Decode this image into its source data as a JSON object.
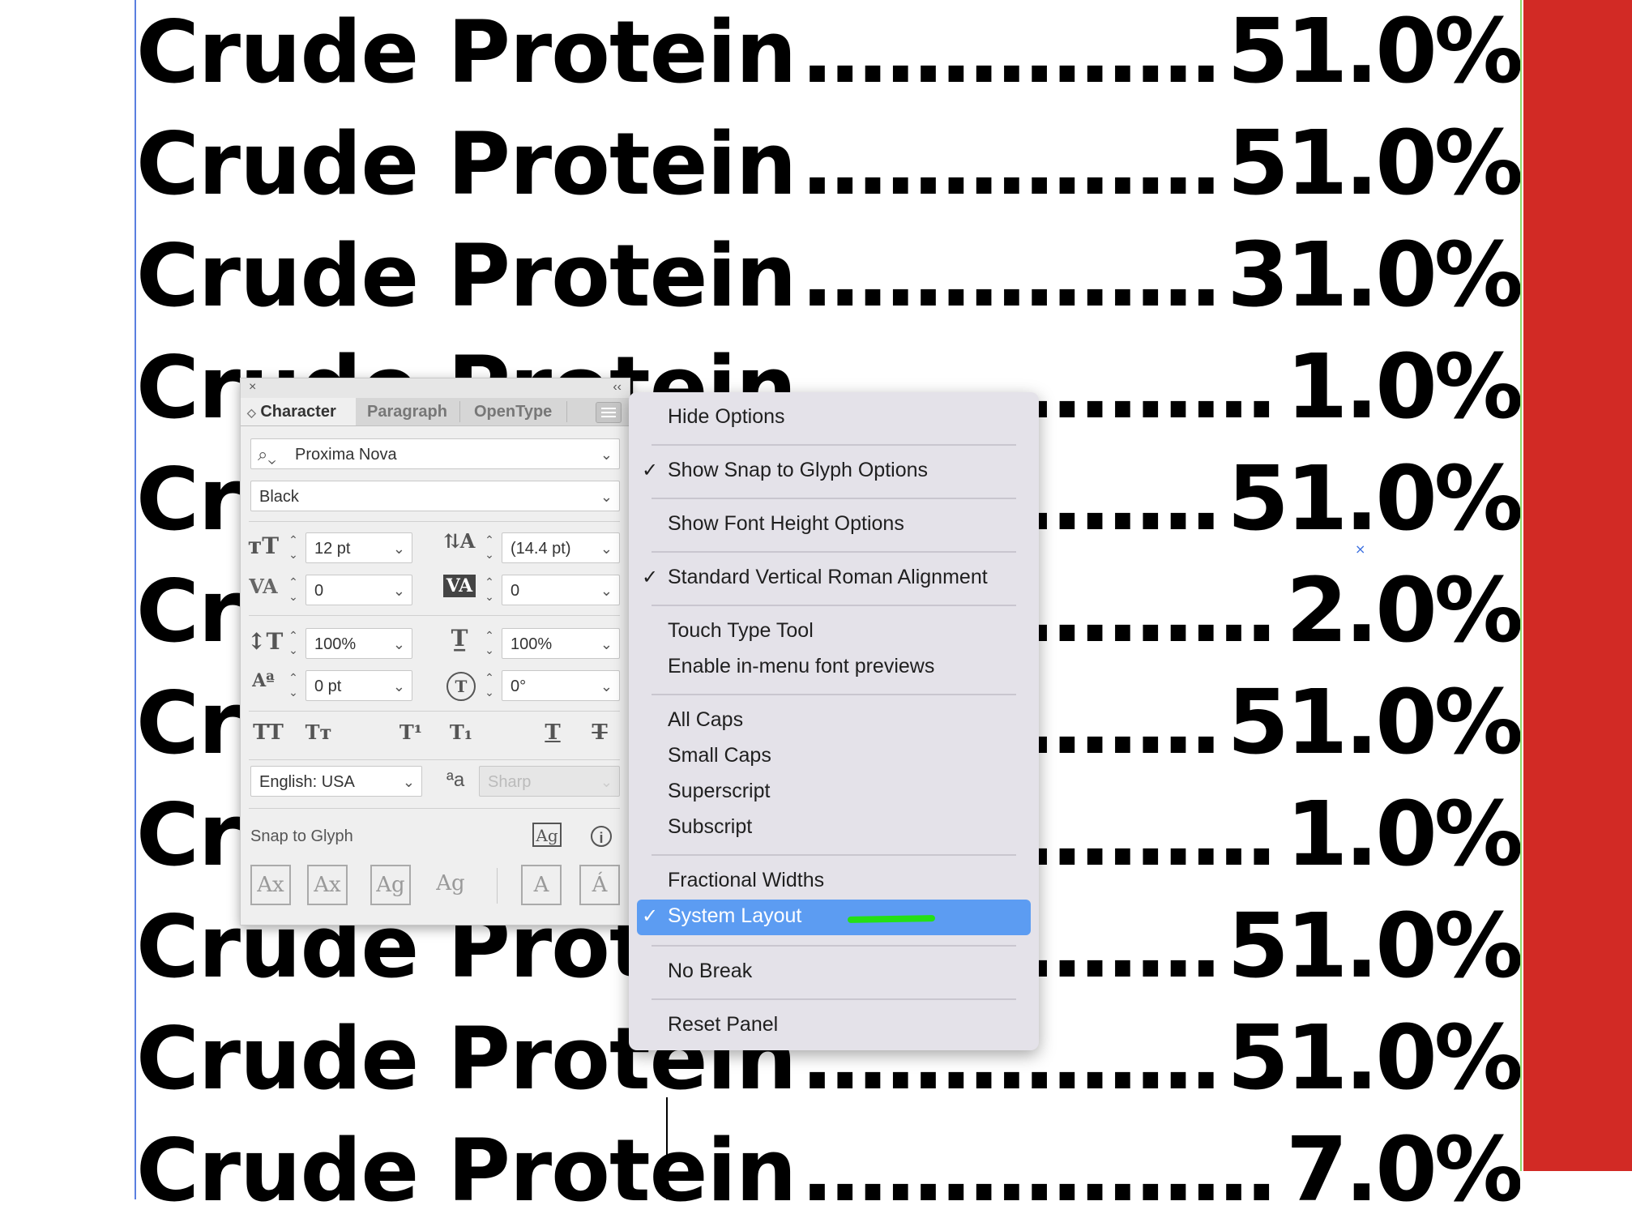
{
  "document": {
    "rows": [
      {
        "label": "Crude Protein",
        "dots": "..........................................",
        "value": "51.0%"
      },
      {
        "label": "Crude Protein",
        "dots": "..........................................",
        "value": "51.0%"
      },
      {
        "label": "Crude Protein",
        "dots": "..........................................",
        "value": "31.0%"
      },
      {
        "label": "Crude Protein",
        "dots": "..........................................",
        "value": "1.0%"
      },
      {
        "label": "Crude Protein",
        "dots": "..........................................",
        "value": "51.0%"
      },
      {
        "label": "Crude Protein",
        "dots": "..........................................",
        "value": "2.0%"
      },
      {
        "label": "Crude Protein",
        "dots": "..........................................",
        "value": "51.0%"
      },
      {
        "label": "Crude Protein",
        "dots": "..........................................",
        "value": "1.0%"
      },
      {
        "label": "Crude Protein",
        "dots": "..........................................",
        "value": "51.0%"
      },
      {
        "label": "Crude Protein",
        "dots": "..........................................",
        "value": "51.0%"
      },
      {
        "label": "Crude Protein",
        "dots": "..........................................",
        "value": "7.0%"
      }
    ],
    "accent_color": "#d22a25",
    "guide_left_color": "#5a7fe0",
    "guide_right_color": "#8fd96a",
    "stray_mark": "×"
  },
  "panel": {
    "close_glyph": "×",
    "collapse_glyph": "‹‹",
    "tabs": [
      "Character",
      "Paragraph",
      "OpenType"
    ],
    "active_tab": "Character",
    "font_family": "Proxima Nova",
    "font_style": "Black",
    "font_size": "12 pt",
    "leading": "(14.4 pt)",
    "kerning": "0",
    "tracking": "0",
    "vertical_scale": "100%",
    "horizontal_scale": "100%",
    "baseline_shift": "0 pt",
    "rotation": "0°",
    "language": "English: USA",
    "anti_alias": "Sharp",
    "snap_to_glyph_label": "Snap to Glyph",
    "icons": {
      "search": "search-icon",
      "font_size": "font-size-icon",
      "leading": "leading-icon",
      "kerning": "kerning-icon",
      "tracking": "tracking-icon",
      "vertical_scale": "vertical-scale-icon",
      "horizontal_scale": "horizontal-scale-icon",
      "baseline": "baseline-shift-icon",
      "rotation": "rotation-icon",
      "all_caps": "TT",
      "small_caps": "Tт",
      "superscript": "T¹",
      "subscript": "T₁",
      "underline": "T",
      "strikethrough": "T",
      "antialias": "ªa",
      "glyph": "Ag",
      "info": "i"
    },
    "snap_buttons": [
      "Ax",
      "Ax",
      "Ag",
      "Ag",
      "A",
      "Á"
    ]
  },
  "flyout": {
    "items": [
      {
        "label": "Hide Options",
        "checked": false
      },
      {
        "label": "Show Snap to Glyph Options",
        "checked": true
      },
      {
        "label": "Show Font Height Options",
        "checked": false
      },
      {
        "label": "Standard Vertical Roman Alignment",
        "checked": true
      },
      {
        "label": "Touch Type Tool",
        "checked": false
      },
      {
        "label": "Enable in-menu font previews",
        "checked": false
      },
      {
        "label": "All Caps",
        "checked": false
      },
      {
        "label": "Small Caps",
        "checked": false
      },
      {
        "label": "Superscript",
        "checked": false
      },
      {
        "label": "Subscript",
        "checked": false
      },
      {
        "label": "Fractional Widths",
        "checked": false
      },
      {
        "label": "System Layout",
        "checked": true,
        "highlighted": true
      },
      {
        "label": "No Break",
        "checked": false
      },
      {
        "label": "Reset Panel",
        "checked": false
      }
    ],
    "check_glyph": "✓",
    "highlight_color": "#5c9cf2",
    "annotation_color": "#24e014"
  }
}
